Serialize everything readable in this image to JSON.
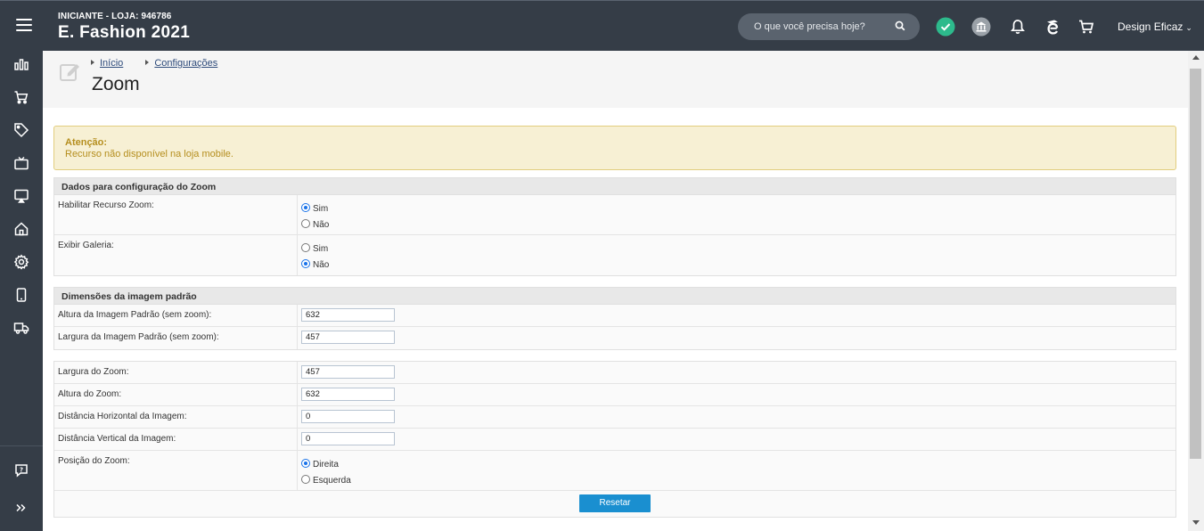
{
  "header": {
    "store_subtitle": "INICIANTE - LOJA: 946786",
    "store_name": "E. Fashion 2021",
    "search_placeholder": "O que você precisa hoje?",
    "user_name": "Design Eficaz",
    "status_color": "#2dba8c"
  },
  "sidebar": {
    "items": [
      "chart-icon",
      "cart-icon",
      "tag-icon",
      "tv-icon",
      "monitor-icon",
      "home-icon",
      "gear-icon",
      "mobile-icon",
      "truck-icon",
      "help-chat-icon",
      "expand-icon"
    ]
  },
  "page": {
    "breadcrumb_home": "Início",
    "breadcrumb_config": "Configurações",
    "title": "Zoom"
  },
  "alert": {
    "title": "Atenção:",
    "text": "Recurso não disponível na loja mobile."
  },
  "section_zoom": {
    "title": "Dados para configuração do Zoom",
    "enable_label": "Habilitar Recurso Zoom:",
    "gallery_label": "Exibir Galeria:",
    "opt_yes": "Sim",
    "opt_no": "Não",
    "enable_value": "Sim",
    "gallery_value": "Não"
  },
  "section_dims": {
    "title": "Dimensões da imagem padrão",
    "height_label": "Altura da Imagem Padrão (sem zoom):",
    "height_value": "632",
    "width_label": "Largura da Imagem Padrão (sem zoom):",
    "width_value": "457"
  },
  "section_zoom_dims": {
    "zoom_width_label": "Largura do Zoom:",
    "zoom_width_value": "457",
    "zoom_height_label": "Altura do Zoom:",
    "zoom_height_value": "632",
    "h_dist_label": "Distância Horizontal da Imagem:",
    "h_dist_value": "0",
    "v_dist_label": "Distância Vertical da Imagem:",
    "v_dist_value": "0",
    "position_label": "Posição do Zoom:",
    "opt_right": "Direita",
    "opt_left": "Esquerda",
    "position_value": "Direita"
  },
  "actions": {
    "reset_label": "Resetar"
  }
}
